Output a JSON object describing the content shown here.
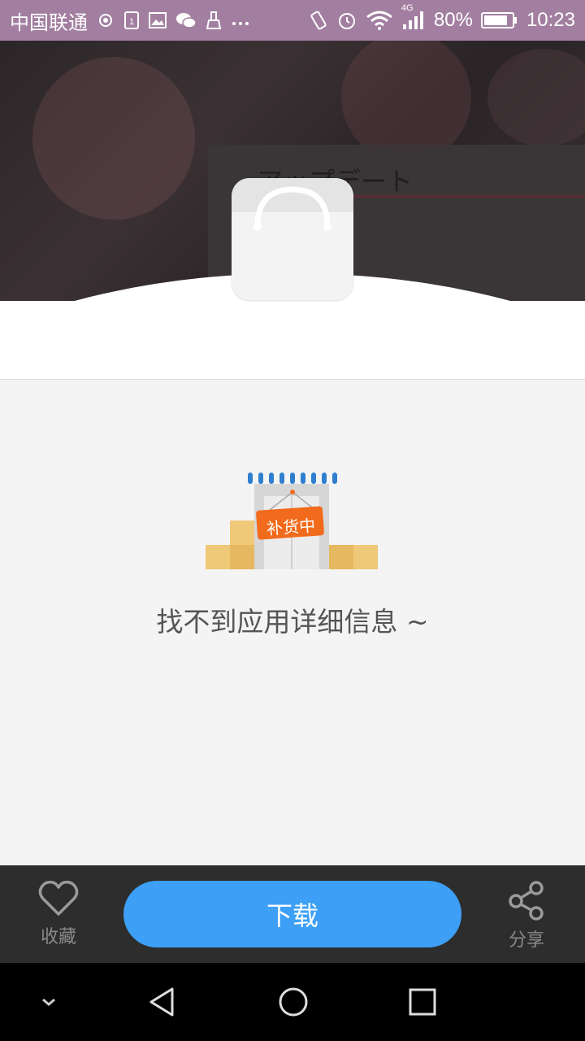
{
  "status_bar": {
    "carrier": "中国联通",
    "network_type": "4G",
    "battery_percent": "80%",
    "time": "10:23",
    "icons": [
      "hotspot-icon",
      "sim-icon",
      "image-icon",
      "wechat-icon",
      "clean-icon",
      "more-icon",
      "vibrate-icon",
      "alarm-icon",
      "wifi-icon",
      "signal-icon",
      "battery-icon"
    ]
  },
  "banner": {
    "card_title": "アップデート"
  },
  "app": {
    "icon": "shopping-bag-icon"
  },
  "empty_state": {
    "illustration": "store-restocking-icon",
    "sign_text": "补货中",
    "message": "找不到应用详细信息 ~"
  },
  "action_bar": {
    "favorite_label": "收藏",
    "download_label": "下载",
    "share_label": "分享",
    "accent_color": "#3d9ff5"
  },
  "nav_bar": {
    "buttons": [
      "collapse-icon",
      "back-icon",
      "home-icon",
      "recents-icon"
    ]
  }
}
